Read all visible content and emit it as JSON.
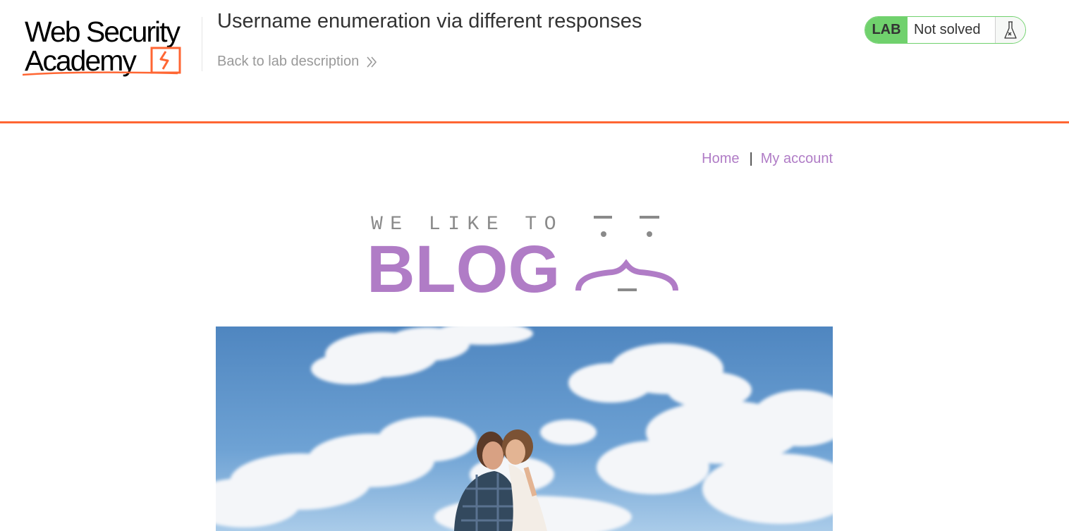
{
  "header": {
    "logo": {
      "line1": "Web Security",
      "line2": "Academy"
    },
    "lab_title": "Username enumeration via different responses",
    "back_link": "Back to lab description",
    "lab_badge": "LAB",
    "lab_status": "Not solved",
    "icons": {
      "back_link_icon": "double-chevron-right-icon",
      "lab_status_icon": "flask-icon"
    },
    "colors": {
      "accent_orange": "#ff6633",
      "lab_green": "#70d16d"
    }
  },
  "site": {
    "nav": {
      "home": "Home",
      "separator": "|",
      "my_account": "My account"
    },
    "blog_logo": {
      "tagline": "WE LIKE TO",
      "word": "BLOG"
    },
    "colors": {
      "link_purple": "#b07cc6"
    }
  }
}
